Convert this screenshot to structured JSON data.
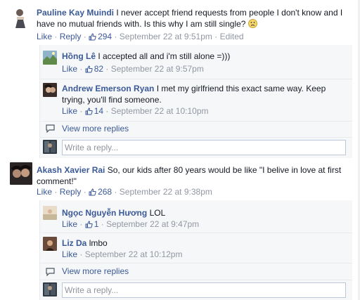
{
  "comments": [
    {
      "author": "Pauline Kay Muindi",
      "text": "I never accept friend requests from people I don't know and I have no mutual friends with. Is this why I am still single?",
      "emoji": "☹",
      "like_label": "Like",
      "reply_label": "Reply",
      "likes": "294",
      "timestamp": "September 22 at 9:51pm",
      "edited": "Edited",
      "replies": [
        {
          "author": "Hồng Lê",
          "text": "I accepted all and i'm still alone =)))",
          "like_label": "Like",
          "likes": "82",
          "timestamp": "September 22 at 9:57pm"
        },
        {
          "author": "Andrew Emerson Ryan",
          "text": "I met my girlfriend this exact same way. Keep trying, you'll find someone.",
          "like_label": "Like",
          "likes": "14",
          "timestamp": "September 22 at 10:10pm"
        }
      ],
      "view_more": "View more replies",
      "reply_placeholder": "Write a reply..."
    },
    {
      "author": "Akash Xavier Rai",
      "text": "So, our kids after 80 years would be like \"I belive in love at first comment!\"",
      "like_label": "Like",
      "reply_label": "Reply",
      "likes": "268",
      "timestamp": "September 22 at 9:38pm",
      "replies": [
        {
          "author": "Ngọc Nguyễn Hương",
          "text": "LOL",
          "like_label": "Like",
          "likes": "1",
          "timestamp": "September 22 at 9:47pm"
        },
        {
          "author": "Liz Da",
          "text": "lmbo",
          "like_label": "Like",
          "timestamp": "September 22 at 10:12pm"
        }
      ],
      "view_more": "View more replies",
      "reply_placeholder": "Write a reply..."
    }
  ],
  "colors": {
    "link": "#3b5998",
    "meta": "#9197a3",
    "reply_bg": "#f6f7f8",
    "border": "#bdc7d8"
  },
  "icons": [
    "like-thumb-icon",
    "view-more-replies-icon",
    "sad-emoji-icon"
  ]
}
